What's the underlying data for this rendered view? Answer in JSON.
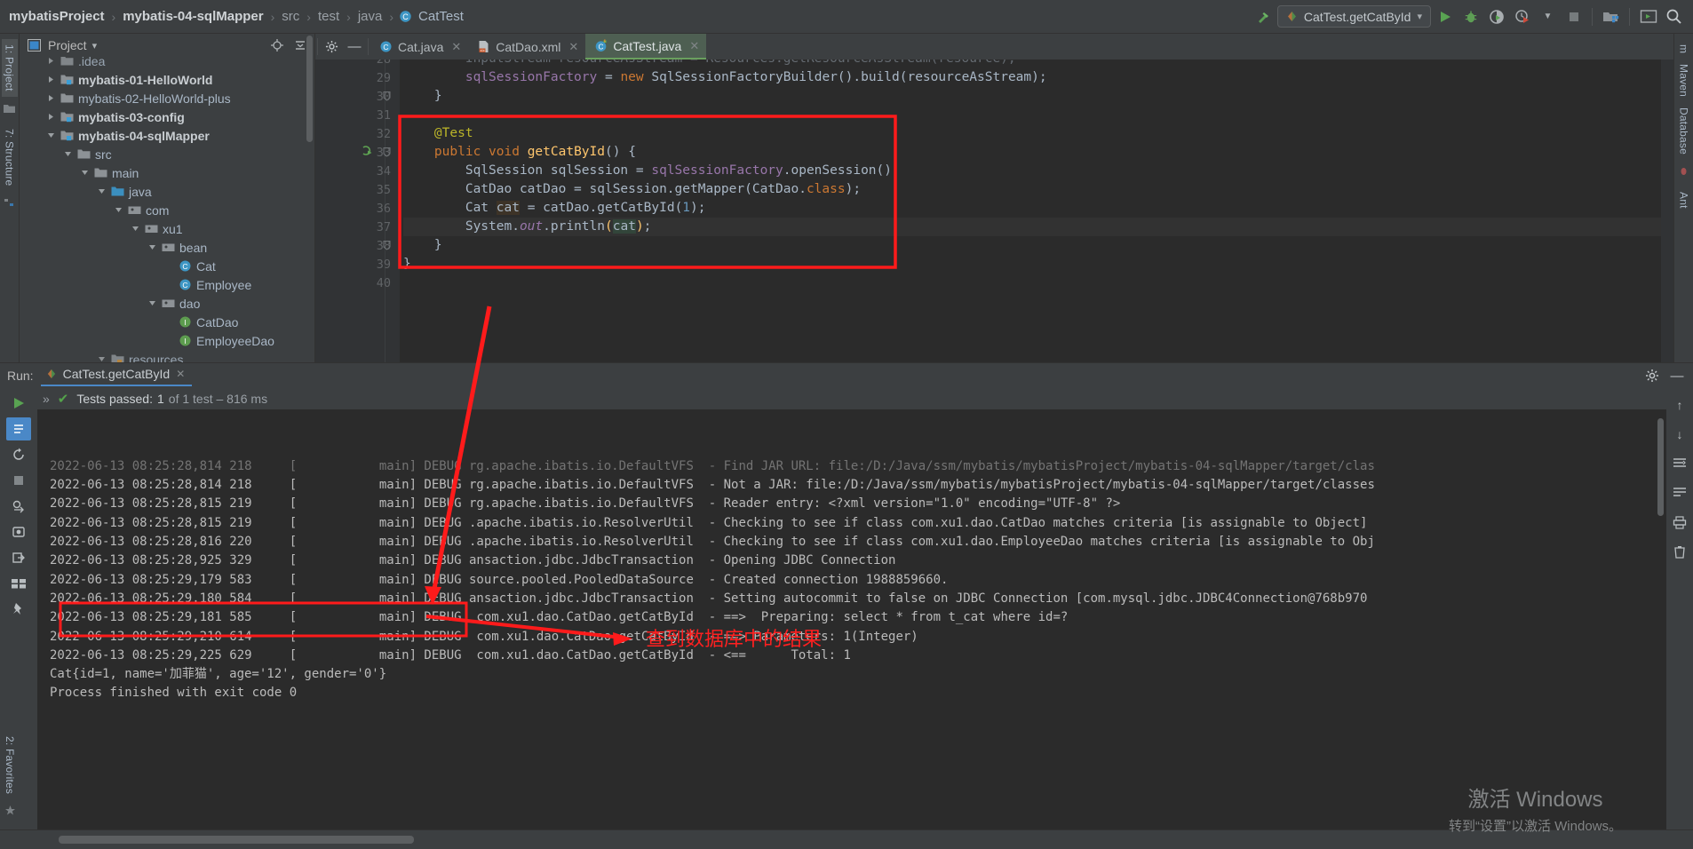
{
  "breadcrumb": {
    "items": [
      {
        "label": "mybatisProject",
        "style": "bold"
      },
      {
        "label": "mybatis-04-sqlMapper",
        "style": "bold"
      },
      {
        "label": "src",
        "style": "dim"
      },
      {
        "label": "test",
        "style": "dim"
      },
      {
        "label": "java",
        "style": "dim"
      },
      {
        "label": "CatTest",
        "style": "normal",
        "icon": "class-icon"
      }
    ],
    "separator": "›"
  },
  "toolbar": {
    "build_icon": "hammer-icon",
    "run_config": "CatTest.getCatById",
    "run_config_dropdown": "▾",
    "buttons": [
      {
        "name": "run-button",
        "glyph": "▶"
      },
      {
        "name": "debug-button",
        "glyph": "bug-icon"
      },
      {
        "name": "run-with-coverage-button",
        "glyph": "coverage-icon"
      },
      {
        "name": "profiler-button",
        "glyph": "profiler-icon"
      },
      {
        "name": "stop-button",
        "glyph": "■"
      },
      {
        "name": "project-structure-button",
        "glyph": "structure-icon"
      },
      {
        "name": "terminal-button",
        "glyph": "terminal-icon"
      },
      {
        "name": "search-everywhere-button",
        "glyph": "search-icon"
      }
    ]
  },
  "left_rail": {
    "tabs": [
      {
        "label": "1: Project",
        "active": true
      },
      {
        "label": "7: Structure",
        "active": false
      }
    ],
    "bottom_tabs": [
      {
        "label": "2: Favorites"
      }
    ]
  },
  "right_rail": {
    "tabs": [
      {
        "label": "m",
        "name": "maven-tab"
      },
      {
        "label": "Maven",
        "name": "maven-tab-label"
      },
      {
        "label": "Database",
        "name": "database-tab"
      },
      {
        "label": "Ant",
        "name": "ant-tab"
      }
    ]
  },
  "project_panel": {
    "title": "Project",
    "dropdown": "▾",
    "actions": [
      {
        "name": "locate-icon",
        "glyph": "⊕"
      },
      {
        "name": "collapse-all-icon",
        "glyph": "⩵"
      },
      {
        "name": "hide-panel-icon",
        "glyph": "—"
      }
    ],
    "tree": [
      {
        "label": ".idea",
        "indent": 1,
        "arrow": "collapsed",
        "icon": "folder",
        "bold": false,
        "clipped": true
      },
      {
        "label": "mybatis-01-HelloWorld",
        "indent": 1,
        "arrow": "collapsed",
        "icon": "module",
        "bold": true
      },
      {
        "label": "mybatis-02-HelloWorld-plus",
        "indent": 1,
        "arrow": "collapsed",
        "icon": "folder",
        "bold": false
      },
      {
        "label": "mybatis-03-config",
        "indent": 1,
        "arrow": "collapsed",
        "icon": "module",
        "bold": true
      },
      {
        "label": "mybatis-04-sqlMapper",
        "indent": 1,
        "arrow": "expanded",
        "icon": "module",
        "bold": true
      },
      {
        "label": "src",
        "indent": 2,
        "arrow": "expanded",
        "icon": "folder",
        "bold": false
      },
      {
        "label": "main",
        "indent": 3,
        "arrow": "expanded",
        "icon": "folder",
        "bold": false
      },
      {
        "label": "java",
        "indent": 4,
        "arrow": "expanded",
        "icon": "srcroot",
        "bold": false
      },
      {
        "label": "com",
        "indent": 5,
        "arrow": "expanded",
        "icon": "package",
        "bold": false
      },
      {
        "label": "xu1",
        "indent": 6,
        "arrow": "expanded",
        "icon": "package",
        "bold": false
      },
      {
        "label": "bean",
        "indent": 7,
        "arrow": "expanded",
        "icon": "package",
        "bold": false
      },
      {
        "label": "Cat",
        "indent": 8,
        "arrow": "none",
        "icon": "class",
        "bold": false
      },
      {
        "label": "Employee",
        "indent": 8,
        "arrow": "none",
        "icon": "class",
        "bold": false
      },
      {
        "label": "dao",
        "indent": 7,
        "arrow": "expanded",
        "icon": "package",
        "bold": false
      },
      {
        "label": "CatDao",
        "indent": 8,
        "arrow": "none",
        "icon": "interface",
        "bold": false
      },
      {
        "label": "EmployeeDao",
        "indent": 8,
        "arrow": "none",
        "icon": "interface",
        "bold": false
      },
      {
        "label": "resources",
        "indent": 4,
        "arrow": "expanded",
        "icon": "resroot",
        "bold": false,
        "clipped": true
      }
    ]
  },
  "editor": {
    "tools": [
      {
        "name": "settings-gear-icon",
        "glyph": "⚙"
      },
      {
        "name": "hide-editor-icon",
        "glyph": "—"
      }
    ],
    "tabs": [
      {
        "label": "Cat.java",
        "icon": "java-class-icon",
        "active": false,
        "close": "✕"
      },
      {
        "label": "CatDao.xml",
        "icon": "xml-file-icon",
        "active": false,
        "close": "✕"
      },
      {
        "label": "CatTest.java",
        "icon": "java-test-icon",
        "active": true,
        "close": "✕"
      }
    ],
    "first_line_number": 28,
    "lines": [
      {
        "num": 28,
        "clipped": true,
        "tokens": [
          {
            "t": "        InputStream resourceAsStream = Resources.getResourceAsStream(resource);",
            "c": "t"
          }
        ]
      },
      {
        "num": 29,
        "tokens": [
          {
            "t": "        ",
            "c": "t"
          },
          {
            "t": "sqlSessionFactory",
            "c": "f"
          },
          {
            "t": " = ",
            "c": "t"
          },
          {
            "t": "new",
            "c": "k"
          },
          {
            "t": " SqlSessionFactoryBuilder().build(resourceAsStream);",
            "c": "t"
          }
        ]
      },
      {
        "num": 30,
        "fold": true,
        "tokens": [
          {
            "t": "    }",
            "c": "t"
          }
        ]
      },
      {
        "num": 31,
        "tokens": [
          {
            "t": "",
            "c": "t"
          }
        ]
      },
      {
        "num": 32,
        "tokens": [
          {
            "t": "    @Test",
            "c": "ann"
          }
        ]
      },
      {
        "num": 33,
        "runmark": true,
        "fold": true,
        "tokens": [
          {
            "t": "    ",
            "c": "t"
          },
          {
            "t": "public void ",
            "c": "k"
          },
          {
            "t": "getCatById",
            "c": "m"
          },
          {
            "t": "() {",
            "c": "t"
          }
        ]
      },
      {
        "num": 34,
        "tokens": [
          {
            "t": "        SqlSession sqlSession = ",
            "c": "t"
          },
          {
            "t": "sqlSessionFactory",
            "c": "f"
          },
          {
            "t": ".openSession();",
            "c": "t"
          }
        ]
      },
      {
        "num": 35,
        "tokens": [
          {
            "t": "        CatDao catDao = sqlSession.getMapper(CatDao.",
            "c": "t"
          },
          {
            "t": "class",
            "c": "k"
          },
          {
            "t": ");",
            "c": "t"
          }
        ]
      },
      {
        "num": 36,
        "tokens": [
          {
            "t": "        Cat ",
            "c": "t"
          },
          {
            "t": "cat",
            "c": "hi-w"
          },
          {
            "t": " = catDao.getCatById(",
            "c": "t"
          },
          {
            "t": "1",
            "c": "n"
          },
          {
            "t": ");",
            "c": "t"
          }
        ]
      },
      {
        "num": 37,
        "highlight": true,
        "tokens": [
          {
            "t": "        System.",
            "c": "t"
          },
          {
            "t": "out",
            "c": "sf"
          },
          {
            "t": ".println",
            "c": "t"
          },
          {
            "t": "(",
            "c": "m"
          },
          {
            "t": "cat",
            "c": "hi-g"
          },
          {
            "t": ")",
            "c": "m"
          },
          {
            "t": ";",
            "c": "t"
          }
        ]
      },
      {
        "num": 38,
        "fold": true,
        "tokens": [
          {
            "t": "    }",
            "c": "t"
          }
        ]
      },
      {
        "num": 39,
        "tokens": [
          {
            "t": "}",
            "c": "t"
          }
        ]
      },
      {
        "num": 40,
        "tokens": [
          {
            "t": "",
            "c": "t"
          }
        ]
      }
    ]
  },
  "run_panel": {
    "label": "Run:",
    "tab": "CatTest.getCatById",
    "tab_close": "✕",
    "tab_icon": "run-config-icon",
    "head_actions": [
      {
        "name": "run-settings-gear-icon",
        "glyph": "⚙"
      },
      {
        "name": "hide-run-panel-icon",
        "glyph": "—"
      }
    ],
    "left_tools": [
      {
        "name": "rerun-button",
        "glyph": "▶",
        "selected": false
      },
      {
        "name": "rerun-failed-tests-button",
        "glyph": "rerun-failed-icon",
        "selected": true
      },
      {
        "name": "toggle-auto-test-button",
        "glyph": "auto-test-icon",
        "selected": false
      },
      {
        "name": "stop-button",
        "glyph": "■",
        "selected": false
      },
      {
        "name": "export-test-results-button",
        "glyph": "export-icon",
        "selected": false
      },
      {
        "name": "open-in-browser-button",
        "glyph": "browser-icon",
        "selected": false
      },
      {
        "name": "import-test-results-button",
        "glyph": "import-icon",
        "selected": false
      },
      {
        "name": "show-statistics-button",
        "glyph": "stats-icon",
        "selected": false
      },
      {
        "name": "pin-tab-button",
        "glyph": "pin-icon",
        "selected": false
      }
    ],
    "status": {
      "expand_glyph": "»",
      "check_glyph": "✔",
      "passed_label": "Tests passed:",
      "passed_count": "1",
      "of_label": "of 1 test – 816 ms"
    },
    "right_tools": [
      {
        "name": "scroll-up-icon",
        "glyph": "↑"
      },
      {
        "name": "scroll-down-icon",
        "glyph": "↓"
      },
      {
        "name": "soft-wrap-icon",
        "glyph": "soft-wrap-icon"
      },
      {
        "name": "scroll-to-end-icon",
        "glyph": "scroll-end-icon"
      },
      {
        "name": "print-icon",
        "glyph": "print-icon"
      },
      {
        "name": "clear-all-icon",
        "glyph": "trash-icon"
      }
    ],
    "console_lines": [
      {
        "text": "2022-06-13 08:25:28,814 218     [           main] DEBUG rg.apache.ibatis.io.DefaultVFS  - Find JAR URL: file:/D:/Java/ssm/mybatis/mybatisProject/mybatis-04-sqlMapper/target/clas",
        "clipped": true
      },
      {
        "text": "2022-06-13 08:25:28,814 218     [           main] DEBUG rg.apache.ibatis.io.DefaultVFS  - Not a JAR: file:/D:/Java/ssm/mybatis/mybatisProject/mybatis-04-sqlMapper/target/classes"
      },
      {
        "text": "2022-06-13 08:25:28,815 219     [           main] DEBUG rg.apache.ibatis.io.DefaultVFS  - Reader entry: <?xml version=\"1.0\" encoding=\"UTF-8\" ?>"
      },
      {
        "text": "2022-06-13 08:25:28,815 219     [           main] DEBUG .apache.ibatis.io.ResolverUtil  - Checking to see if class com.xu1.dao.CatDao matches criteria [is assignable to Object]"
      },
      {
        "text": "2022-06-13 08:25:28,816 220     [           main] DEBUG .apache.ibatis.io.ResolverUtil  - Checking to see if class com.xu1.dao.EmployeeDao matches criteria [is assignable to Obj"
      },
      {
        "text": "2022-06-13 08:25:28,925 329     [           main] DEBUG ansaction.jdbc.JdbcTransaction  - Opening JDBC Connection"
      },
      {
        "text": "2022-06-13 08:25:29,179 583     [           main] DEBUG source.pooled.PooledDataSource  - Created connection 1988859660."
      },
      {
        "text": "2022-06-13 08:25:29,180 584     [           main] DEBUG ansaction.jdbc.JdbcTransaction  - Setting autocommit to false on JDBC Connection [com.mysql.jdbc.JDBC4Connection@768b970"
      },
      {
        "text": "2022-06-13 08:25:29,181 585     [           main] DEBUG  com.xu1.dao.CatDao.getCatById  - ==>  Preparing: select * from t_cat where id=?"
      },
      {
        "text": "2022-06-13 08:25:29,210 614     [           main] DEBUG  com.xu1.dao.CatDao.getCatById  - ==> Parameters: 1(Integer)"
      },
      {
        "text": "2022-06-13 08:25:29,225 629     [           main] DEBUG  com.xu1.dao.CatDao.getCatById  - <==      Total: 1"
      },
      {
        "text": "Cat{id=1, name='加菲猫', age='12', gender='0'}"
      },
      {
        "text": ""
      },
      {
        "text": "Process finished with exit code 0"
      }
    ]
  },
  "annotations": {
    "code_box": "red-rectangle-around-test-method",
    "result_box": "red-rectangle-around-cat-output",
    "arrow_code_to_result": "red-arrow",
    "arrow_to_caption": "red-arrow",
    "caption": "查到数据库中的结果"
  },
  "watermark": {
    "line1": "激活 Windows",
    "line2": "转到“设置”以激活 Windows。"
  },
  "colors": {
    "accent_red": "#ff1b1b",
    "ide_bg": "#3c3f41",
    "editor_bg": "#2b2b2b",
    "green": "#6aa05e",
    "blue": "#4a88c7"
  }
}
